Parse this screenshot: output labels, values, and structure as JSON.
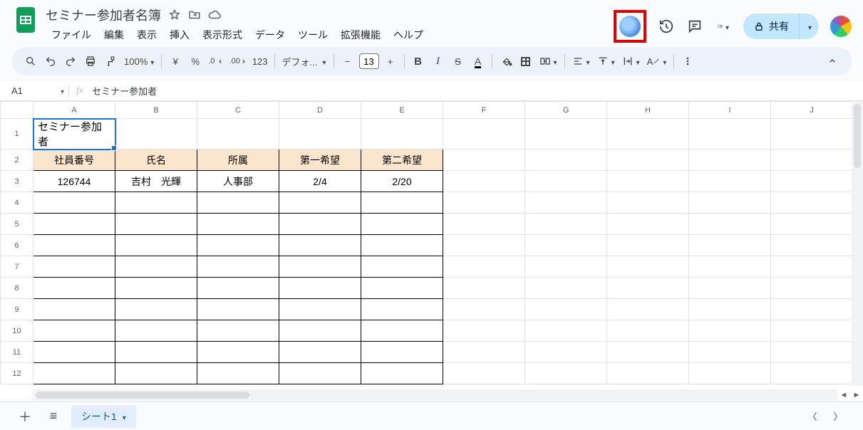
{
  "doc": {
    "title": "セミナー参加者名簿"
  },
  "menus": [
    "ファイル",
    "編集",
    "表示",
    "挿入",
    "表示形式",
    "データ",
    "ツール",
    "拡張機能",
    "ヘルプ"
  ],
  "share": {
    "label": "共有"
  },
  "toolbar": {
    "zoom": "100%",
    "currency": "¥",
    "percent": "%",
    "dec_dec": ".0",
    "dec_inc": ".00",
    "numfmt": "123",
    "font": "デフォ...",
    "fontsize": "13",
    "bold": "B",
    "italic": "I",
    "strike": "S",
    "textcolor": "A"
  },
  "namebox": {
    "ref": "A1"
  },
  "formula": {
    "value": "セミナー参加者"
  },
  "columns": [
    "A",
    "B",
    "C",
    "D",
    "E",
    "F",
    "G",
    "H",
    "I",
    "J"
  ],
  "rows": [
    "1",
    "2",
    "3",
    "4",
    "5",
    "6",
    "7",
    "8",
    "9",
    "10",
    "11",
    "12"
  ],
  "cells": {
    "A1": "セミナー参加者",
    "A2": "社員番号",
    "B2": "氏名",
    "C2": "所属",
    "D2": "第一希望",
    "E2": "第二希望",
    "A3": "126744",
    "B3": "吉村　光輝",
    "C3": "人事部",
    "D3": "2/4",
    "E3": "2/20"
  },
  "sheet": {
    "name": "シート1"
  }
}
